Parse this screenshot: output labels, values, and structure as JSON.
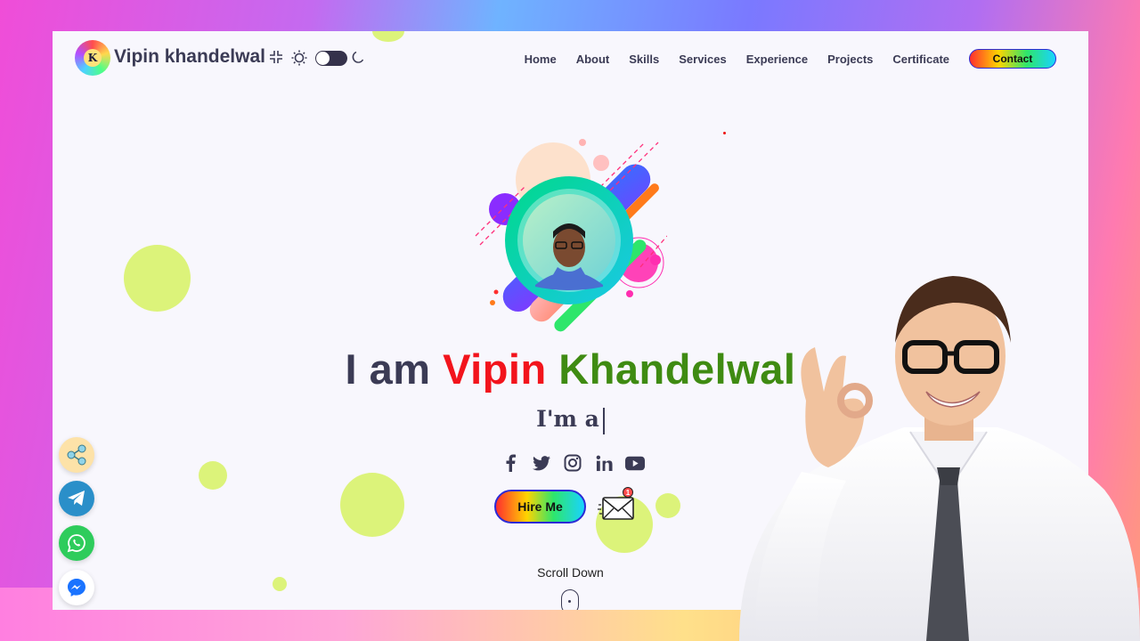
{
  "header": {
    "brand": "Vipin khandelwal",
    "logo_letter": "K",
    "nav": [
      "Home",
      "About",
      "Skills",
      "Services",
      "Experience",
      "Projects",
      "Certificate"
    ],
    "contact_label": "Contact"
  },
  "hero": {
    "title_prefix": "I am",
    "title_first": "Vipin",
    "title_last": "Khandelwal",
    "typed_text": "I'm a",
    "hire_label": "Hire Me",
    "scroll_label": "Scroll Down",
    "notification_count": "1"
  },
  "socials": [
    "facebook-icon",
    "twitter-icon",
    "instagram-icon",
    "linkedin-icon",
    "youtube-icon"
  ],
  "floating": [
    "share-icon",
    "telegram-icon",
    "whatsapp-icon",
    "messenger-icon"
  ],
  "colors": {
    "text": "#3b3b55",
    "red": "#f2141c",
    "green": "#3f8b12",
    "blob": "#dcf37a",
    "telegram": "#2a8fc9",
    "whatsapp": "#2ecc5c",
    "messenger": "#1a73ff"
  }
}
